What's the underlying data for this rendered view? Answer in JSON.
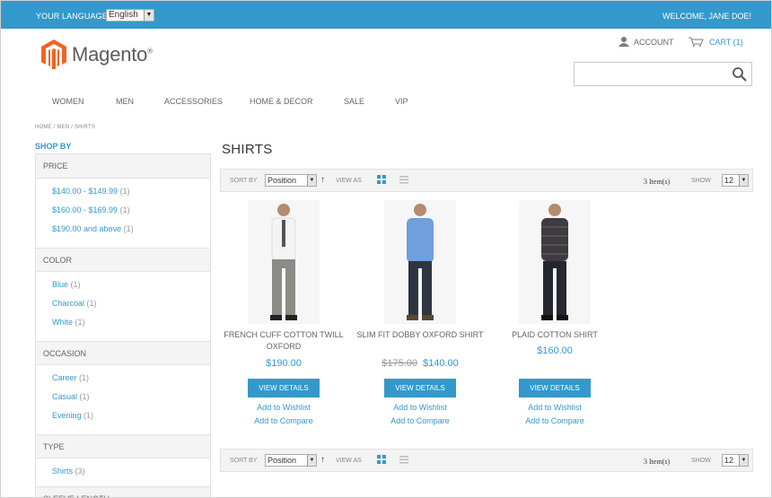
{
  "topbar": {
    "language_label": "YOUR LANGUAGE",
    "language_value": "English",
    "welcome": "WELCOME, JANE DOE!"
  },
  "header": {
    "logo_text": "Magento",
    "logo_reg": "®",
    "account_label": "ACCOUNT",
    "cart_label": "CART (1)",
    "search_placeholder": ""
  },
  "nav": {
    "items": [
      "WOMEN",
      "MEN",
      "ACCESSORIES",
      "HOME & DECOR",
      "SALE",
      "VIP"
    ]
  },
  "breadcrumb": "HOME / MEN / SHIRTS",
  "sidebar": {
    "shop_by": "SHOP BY",
    "filters": [
      {
        "title": "PRICE",
        "options": [
          {
            "label": "$140.00 - $149.99",
            "count": "(1)"
          },
          {
            "label": "$160.00 - $169.99",
            "count": "(1)"
          },
          {
            "label": "$190.00 and above",
            "count": "(1)"
          }
        ]
      },
      {
        "title": "COLOR",
        "options": [
          {
            "label": "Blue",
            "count": "(1)"
          },
          {
            "label": "Charcoal",
            "count": "(1)"
          },
          {
            "label": "White",
            "count": "(1)"
          }
        ]
      },
      {
        "title": "OCCASION",
        "options": [
          {
            "label": "Career",
            "count": "(1)"
          },
          {
            "label": "Casual",
            "count": "(1)"
          },
          {
            "label": "Evening",
            "count": "(1)"
          }
        ]
      },
      {
        "title": "TYPE",
        "options": [
          {
            "label": "Shirts",
            "count": "(3)"
          }
        ]
      },
      {
        "title": "SLEEVE LENGTH",
        "options": []
      }
    ]
  },
  "main": {
    "title": "SHIRTS",
    "toolbar": {
      "sort_label": "SORT BY",
      "sort_value": "Position",
      "direction": "↑",
      "view_label": "VIEW AS",
      "count": "3 Item(s)",
      "show_label": "SHOW",
      "limit_value": "12"
    },
    "products": [
      {
        "name": "FRENCH CUFF COTTON TWILL OXFORD",
        "price": "$190.00",
        "old_price": "",
        "button": "VIEW DETAILS",
        "wishlist": "Add to Wishlist",
        "compare": "Add to Compare",
        "shirt_color": "#f4f4f6",
        "pant_color": "#8a8c86"
      },
      {
        "name": "SLIM FIT DOBBY OXFORD SHIRT",
        "price": "$140.00",
        "old_price": "$175.00",
        "button": "VIEW DETAILS",
        "wishlist": "Add to Wishlist",
        "compare": "Add to Compare",
        "shirt_color": "#6f9fdc",
        "pant_color": "#2e3440"
      },
      {
        "name": "PLAID COTTON SHIRT",
        "price": "$160.00",
        "old_price": "",
        "button": "VIEW DETAILS",
        "wishlist": "Add to Wishlist",
        "compare": "Add to Compare",
        "shirt_color": "#3e3c40",
        "pant_color": "#25272e"
      }
    ]
  },
  "colors": {
    "accent": "#3399cc",
    "topbar": "#3399cc",
    "logo_orange": "#f26322"
  }
}
